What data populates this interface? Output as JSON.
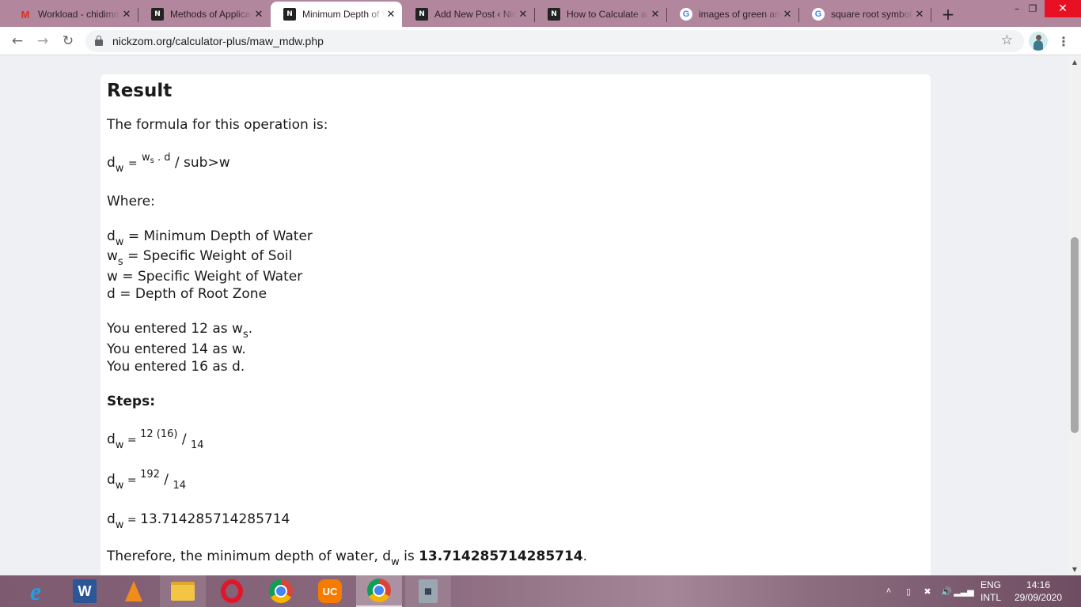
{
  "browser": {
    "tabs": [
      {
        "favicon": "gmail-icon",
        "title": "Workload - chidimma",
        "close": "✕"
      },
      {
        "favicon": "nickzom-icon",
        "title": "Methods of Application",
        "close": "✕"
      },
      {
        "favicon": "nickzom-icon",
        "title": "Minimum Depth of Water",
        "close": "✕",
        "active": true
      },
      {
        "favicon": "nickzom-icon",
        "title": "Add New Post ‹ Nickzom",
        "close": "✕"
      },
      {
        "favicon": "nickzom-icon",
        "title": "How to Calculate and",
        "close": "✕"
      },
      {
        "favicon": "google-icon",
        "title": "images of green and",
        "close": "✕"
      },
      {
        "favicon": "google-icon",
        "title": "square root symbol",
        "close": "✕"
      }
    ],
    "new_tab": "+",
    "window_controls": {
      "minimize": "–",
      "restore": "❐",
      "close": "✕"
    },
    "nav": {
      "back": "←",
      "forward": "→",
      "reload": "↻"
    },
    "url": "nickzom.org/calculator-plus/maw_mdw.php",
    "bookmark_star": "☆",
    "menu": "⋮"
  },
  "result": {
    "heading": "Result",
    "formula_intro": "The formula for this operation is:",
    "formula": {
      "lhs": "d",
      "lhs_sub": "w",
      "eq": "=",
      "num": "w",
      "num_sub": "s",
      "num_rest": " . d",
      "den": "/ sub>w"
    },
    "where_label": "Where:",
    "definitions": [
      {
        "sym": "d",
        "sub": "w",
        "text": " = Minimum Depth of Water"
      },
      {
        "sym": "w",
        "sub": "s",
        "text": " = Specific Weight of Soil"
      },
      {
        "sym": "w",
        "sub": "",
        "text": " = Specific Weight of Water"
      },
      {
        "sym": "d",
        "sub": "",
        "text": " = Depth of Root Zone"
      }
    ],
    "entered": [
      {
        "prefix": "You entered 12 as w",
        "sub": "s",
        "suffix": "."
      },
      {
        "prefix": "You entered 14 as w.",
        "sub": "",
        "suffix": ""
      },
      {
        "prefix": "You entered 16 as d.",
        "sub": "",
        "suffix": ""
      }
    ],
    "steps_label": "Steps:",
    "steps": [
      {
        "lhs": "d",
        "lhs_sub": "w",
        "eq": " = ",
        "num": "12 (16)",
        "slash": " / ",
        "den": "14"
      },
      {
        "lhs": "d",
        "lhs_sub": "w",
        "eq": " = ",
        "num": "192",
        "slash": " / ",
        "den": "14"
      },
      {
        "lhs": "d",
        "lhs_sub": "w",
        "eq": " = ",
        "value": "13.714285714285714"
      }
    ],
    "conclusion": {
      "text": "Therefore, the minimum depth of water, d",
      "sub": "w",
      "mid": " is ",
      "value": "13.714285714285714",
      "end": "."
    }
  },
  "taskbar": {
    "apps": [
      {
        "name": "internet-explorer",
        "glyph": "e"
      },
      {
        "name": "word",
        "glyph": "W"
      },
      {
        "name": "vlc",
        "glyph": ""
      },
      {
        "name": "file-explorer",
        "glyph": ""
      },
      {
        "name": "opera",
        "glyph": ""
      },
      {
        "name": "chrome",
        "glyph": ""
      },
      {
        "name": "uc-browser",
        "glyph": "UC"
      },
      {
        "name": "chrome-active",
        "glyph": ""
      },
      {
        "name": "calculator",
        "glyph": "▦"
      }
    ],
    "tray": {
      "chevron": "˄",
      "lang_top": "ENG",
      "lang_bottom": "INTL",
      "time": "14:16",
      "date": "29/09/2020"
    }
  }
}
